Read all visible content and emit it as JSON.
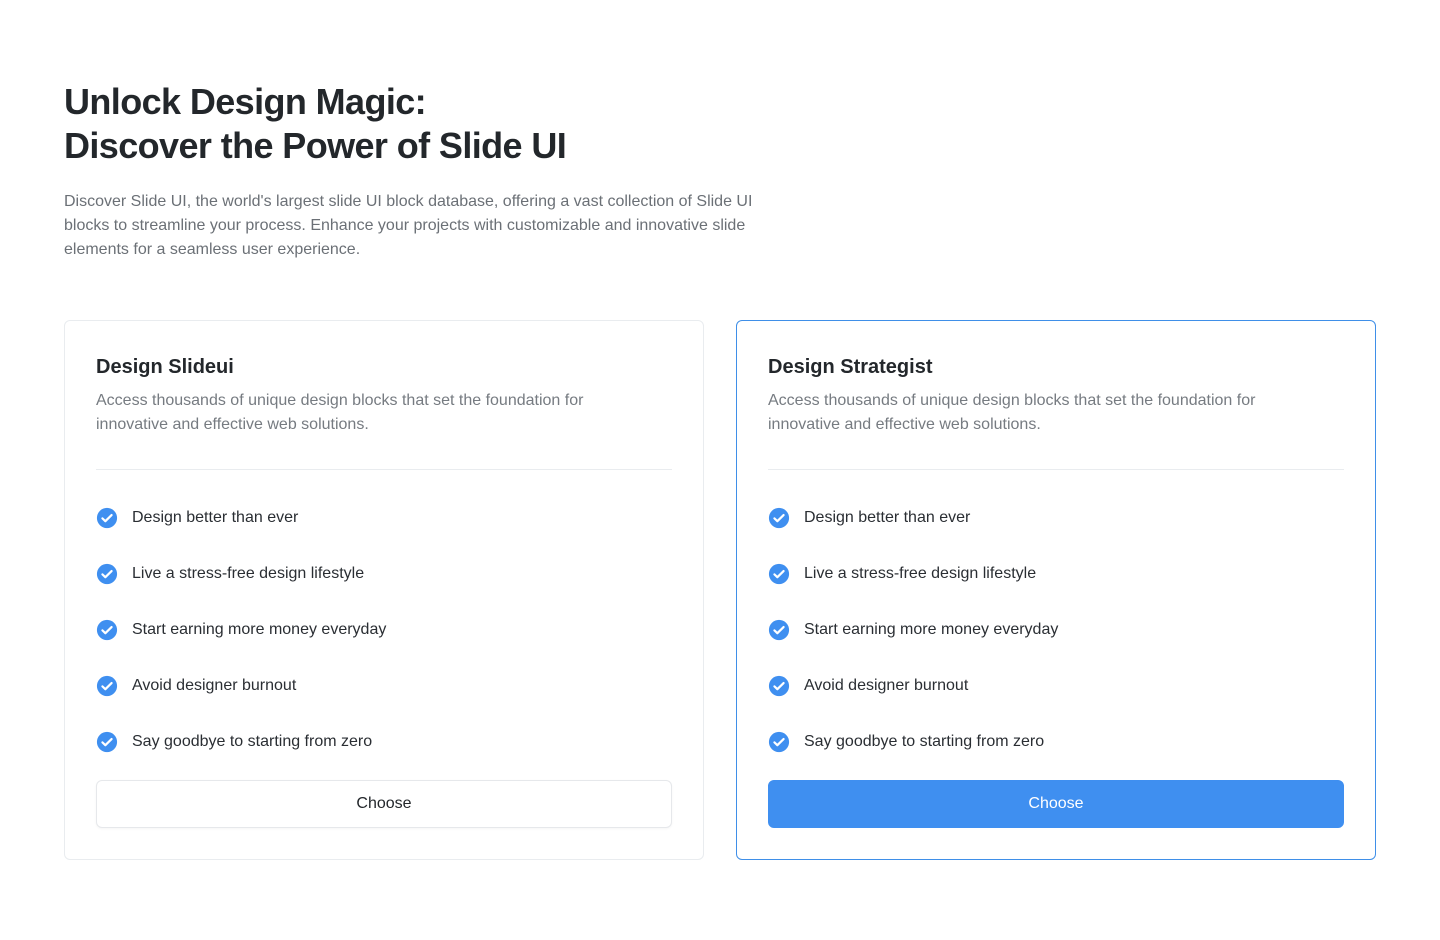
{
  "hero": {
    "title_line1": "Unlock Design Magic:",
    "title_line2": "Discover the Power of Slide UI",
    "description": "Discover Slide UI, the world's largest slide UI block database, offering a vast collection of Slide UI blocks to streamline your process. Enhance your projects with customizable and innovative slide elements for a seamless user experience."
  },
  "colors": {
    "accent": "#3f8ff0",
    "featured_border": "#3f8fe8",
    "check": "#3f8ff0"
  },
  "cards": [
    {
      "title": "Design Slideui",
      "description": "Access thousands of unique design blocks that set the foundation for innovative and effective web solutions.",
      "features": [
        "Design better than ever",
        "Live a stress-free design lifestyle",
        "Start earning more money everyday",
        "Avoid designer burnout",
        "Say goodbye to starting from zero"
      ],
      "button_label": "Choose",
      "icon": "check-circle-icon"
    },
    {
      "title": "Design Strategist",
      "description": "Access thousands of unique design blocks that set the foundation for innovative and effective web solutions.",
      "features": [
        "Design better than ever",
        "Live a stress-free design lifestyle",
        "Start earning more money everyday",
        "Avoid designer burnout",
        "Say goodbye to starting from zero"
      ],
      "button_label": "Choose",
      "icon": "check-circle-icon"
    }
  ]
}
